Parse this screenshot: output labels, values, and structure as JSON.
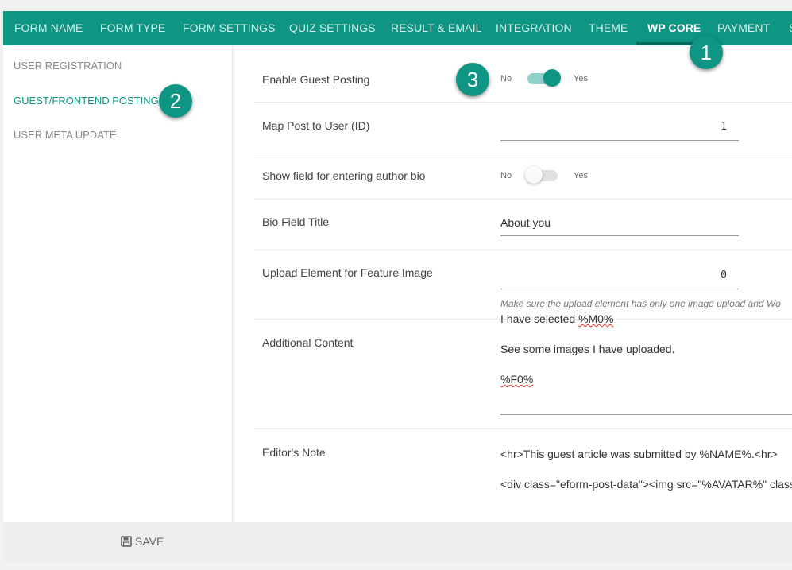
{
  "tabs": [
    {
      "label": "FORM NAME"
    },
    {
      "label": "FORM TYPE"
    },
    {
      "label": "FORM SETTINGS"
    },
    {
      "label": "QUIZ SETTINGS"
    },
    {
      "label": "RESULT & EMAIL"
    },
    {
      "label": "INTEGRATION"
    },
    {
      "label": "THEME"
    },
    {
      "label": "WP CORE",
      "active": true
    },
    {
      "label": "PAYMENT"
    },
    {
      "label": "S"
    }
  ],
  "sidebar": {
    "items": [
      {
        "label": "USER REGISTRATION"
      },
      {
        "label": "GUEST/FRONTEND POSTING",
        "active": true
      },
      {
        "label": "USER META UPDATE"
      }
    ]
  },
  "settings": {
    "enable_guest": {
      "label": "Enable Guest Posting",
      "no": "No",
      "yes": "Yes",
      "state": "on"
    },
    "map_post": {
      "label": "Map Post to User (ID)",
      "value": "1"
    },
    "author_bio": {
      "label": "Show field for entering author bio",
      "no": "No",
      "yes": "Yes",
      "state": "off"
    },
    "bio_title": {
      "label": "Bio Field Title",
      "value": "About you"
    },
    "feature_image": {
      "label": "Upload Element for Feature Image",
      "value": "0",
      "hint": "Make sure the upload element has only one image upload and Wo"
    },
    "additional": {
      "label": "Additional Content",
      "line1_a": "I have selected ",
      "line1_b": "%M0%",
      "line2": "See some images I have uploaded.",
      "line3": "%F0%"
    },
    "editors_note": {
      "label": "Editor's Note",
      "line1": "<hr>This guest article was submitted by %NAME%.<hr>",
      "line2": "<div class=\"eform-post-data\"><img src=\"%AVATAR%\" class="
    }
  },
  "footer": {
    "save_label": "SAVE",
    "save_icon": "floppy-disk-icon"
  },
  "badges": {
    "one": "1",
    "two": "2",
    "three": "3"
  },
  "colors": {
    "accent": "#0e9583",
    "accent_dark": "#06695c",
    "toggle_track": "#8fd1c8"
  }
}
